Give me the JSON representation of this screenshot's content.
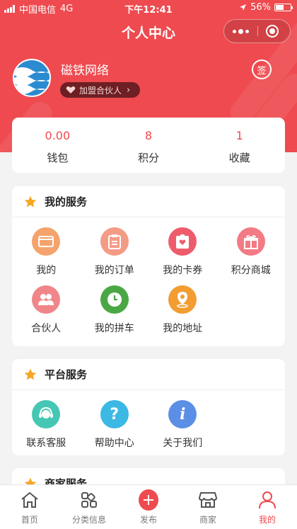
{
  "status_bar": {
    "carrier": "中国电信",
    "network": "4G",
    "time": "下午12:41",
    "battery": "56%",
    "battery_level": 0.56
  },
  "nav": {
    "title": "个人中心"
  },
  "profile": {
    "username": "磁铁网络",
    "partner_badge": "加盟合伙人",
    "sign_label": "签"
  },
  "stats": [
    {
      "value": "0.00",
      "label": "钱包"
    },
    {
      "value": "8",
      "label": "积分"
    },
    {
      "value": "1",
      "label": "收藏"
    }
  ],
  "my_services": {
    "title": "我的服务",
    "items": [
      {
        "label": "我的",
        "icon": "wallet-icon",
        "color": "#f5a36c"
      },
      {
        "label": "我的订单",
        "icon": "order-icon",
        "color": "#f49b86"
      },
      {
        "label": "我的卡券",
        "icon": "coupon-icon",
        "color": "#ee5b6b"
      },
      {
        "label": "积分商城",
        "icon": "gift-icon",
        "color": "#f27b86"
      },
      {
        "label": "合伙人",
        "icon": "partners-icon",
        "color": "#f0868a"
      },
      {
        "label": "我的拼车",
        "icon": "clock-icon",
        "color": "#4aa844"
      },
      {
        "label": "我的地址",
        "icon": "location-icon",
        "color": "#f29c32"
      }
    ]
  },
  "platform_services": {
    "title": "平台服务",
    "items": [
      {
        "label": "联系客服",
        "icon": "customer-service-icon",
        "color": "#45c7b3"
      },
      {
        "label": "帮助中心",
        "icon": "help-icon",
        "color": "#3cb8e4"
      },
      {
        "label": "关于我们",
        "icon": "info-icon",
        "color": "#5b8fe6"
      }
    ]
  },
  "merchant_services": {
    "title": "商家服务"
  },
  "tabbar": [
    {
      "label": "首页",
      "icon": "home-icon"
    },
    {
      "label": "分类信息",
      "icon": "category-icon"
    },
    {
      "label": "发布",
      "icon": "plus-icon"
    },
    {
      "label": "商家",
      "icon": "store-icon"
    },
    {
      "label": "我的",
      "icon": "user-icon",
      "active": true
    }
  ],
  "colors": {
    "brand": "#ee4a4f",
    "badge": "#6d1f23",
    "star": "#f5a623"
  }
}
